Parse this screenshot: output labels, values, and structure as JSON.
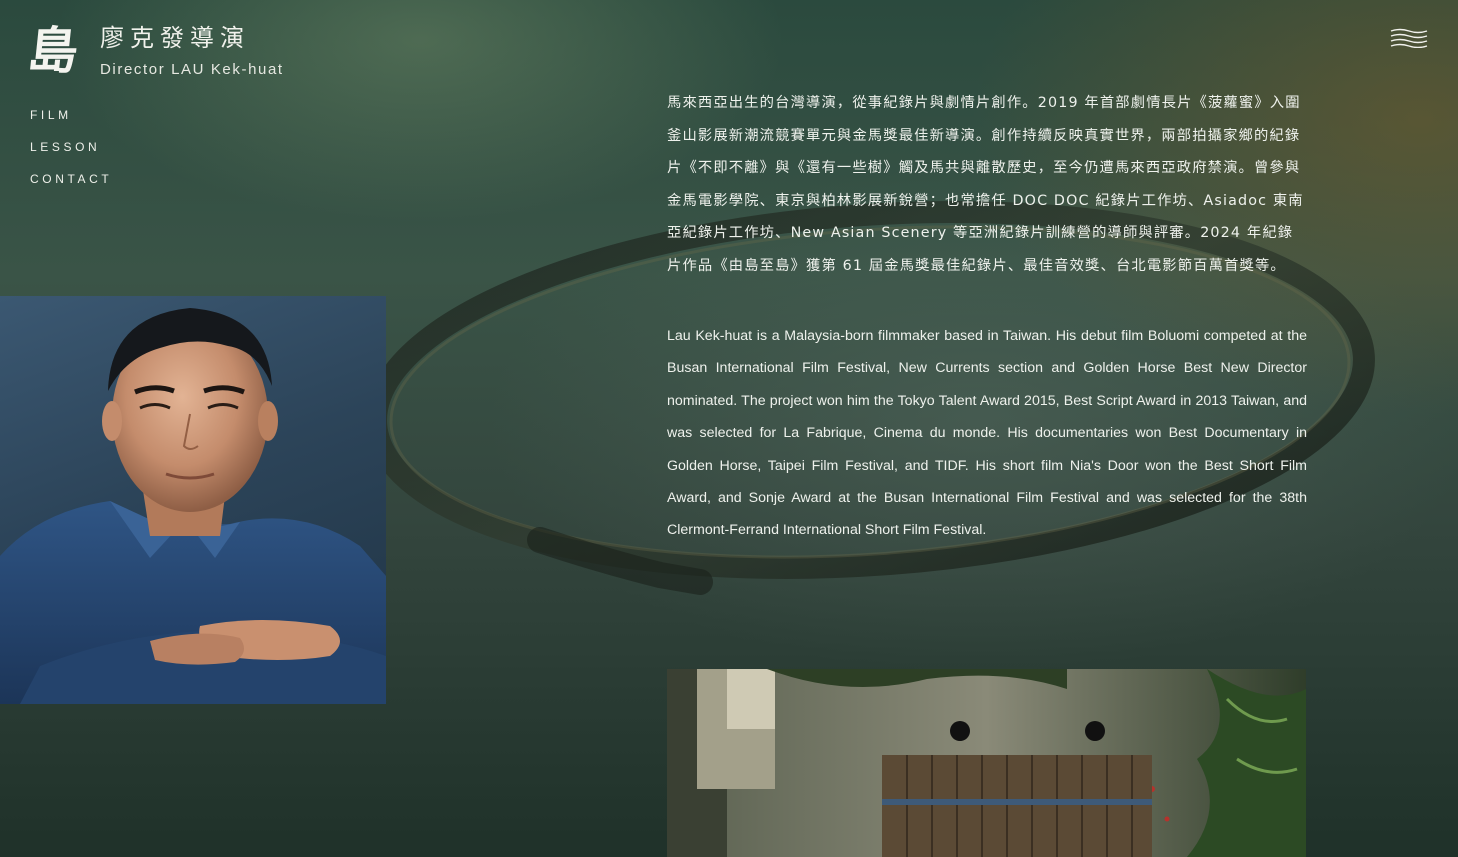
{
  "site": {
    "logo_mark": "島",
    "title_zh": "廖克發導演",
    "title_en": "Director LAU Kek-huat"
  },
  "nav": {
    "items": [
      {
        "label": "FILM"
      },
      {
        "label": "LESSON"
      },
      {
        "label": "CONTACT"
      }
    ]
  },
  "menu": {
    "icon": "hamburger-menu-icon"
  },
  "portrait": {
    "icon": "portrait-photo"
  },
  "bio": {
    "zh": "馬來西亞出生的台灣導演，從事紀錄片與劇情片創作。2019 年首部劇情長片《菠蘿蜜》入圍釜山影展新潮流競賽單元與金馬獎最佳新導演。創作持續反映真實世界，兩部拍攝家鄉的紀錄片《不即不離》與《還有一些樹》觸及馬共與離散歷史，至今仍遭馬來西亞政府禁演。曾參與金馬電影學院、東京與柏林影展新銳營；也常擔任 DOC DOC 紀錄片工作坊、Asiadoc 東南亞紀錄片工作坊、New Asian Scenery 等亞洲紀錄片訓練營的導師與評審。2024 年紀錄片作品《由島至島》獲第 61 屆金馬獎最佳紀錄片、最佳音效獎、台北電影節百萬首獎等。",
    "en": "Lau Kek-huat is a Malaysia-born filmmaker based in Taiwan. His debut film Boluomi competed at the Busan International Film Festival, New Currents section and Golden Horse  Best New Director nominated. The project won him the Tokyo Talent Award 2015, Best Script Award in 2013 Taiwan, and was selected for La Fabrique, Cinema du monde. His documentaries won Best Documentary in Golden Horse, Taipei Film Festival, and TIDF. His short film Nia's Door won the Best Short Film Award, and Sonje Award at the Busan International Film Festival and was selected for the 38th Clermont-Ferrand International Short Film Festival."
  },
  "colors": {
    "background": "#33453d",
    "text": "#eef1ec"
  }
}
